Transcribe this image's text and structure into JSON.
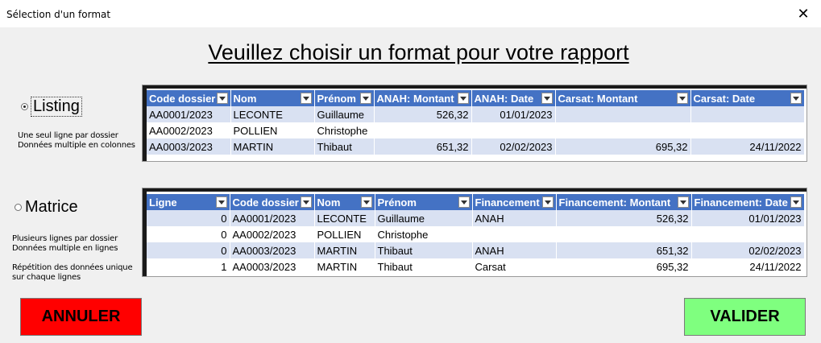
{
  "window": {
    "title": "Sélection d'un format",
    "close_glyph": "✕"
  },
  "heading": "Veuillez choisir un format pour votre rapport",
  "listing": {
    "label": "Listing",
    "selected": true,
    "desc": [
      "Une seul ligne par dossier",
      "Données multiple en colonnes"
    ],
    "columns": [
      "Code dossier",
      "Nom",
      "Prénom",
      "ANAH: Montant",
      "ANAH: Date",
      "Carsat: Montant",
      "Carsat: Date"
    ],
    "rows": [
      [
        "AA0001/2023",
        "LECONTE",
        "Guillaume",
        "526,32",
        "01/01/2023",
        "",
        ""
      ],
      [
        "AA0002/2023",
        "POLLIEN",
        "Christophe",
        "",
        "",
        "",
        ""
      ],
      [
        "AA0003/2023",
        "MARTIN",
        "Thibaut",
        "651,32",
        "02/02/2023",
        "695,32",
        "24/11/2022"
      ]
    ]
  },
  "matrice": {
    "label": "Matrice",
    "selected": false,
    "desc": [
      "Plusieurs lignes par dossier",
      "Données multiple en lignes",
      "",
      "Répétition des données unique",
      "sur chaque lignes"
    ],
    "columns": [
      "Ligne",
      "Code dossier",
      "Nom",
      "Prénom",
      "Financement",
      "Financement: Montant",
      "Financement: Date"
    ],
    "rows": [
      [
        "0",
        "AA0001/2023",
        "LECONTE",
        "Guillaume",
        "ANAH",
        "526,32",
        "01/01/2023"
      ],
      [
        "0",
        "AA0002/2023",
        "POLLIEN",
        "Christophe",
        "",
        "",
        ""
      ],
      [
        "0",
        "AA0003/2023",
        "MARTIN",
        "Thibaut",
        "ANAH",
        "651,32",
        "02/02/2023"
      ],
      [
        "1",
        "AA0003/2023",
        "MARTIN",
        "Thibaut",
        "Carsat",
        "695,32",
        "24/11/2022"
      ]
    ]
  },
  "buttons": {
    "cancel": "ANNULER",
    "ok": "VALIDER"
  },
  "colors": {
    "header": "#4472c4",
    "band": "#d9e1f2",
    "cancel": "#ff0000",
    "ok": "#7fff7f"
  }
}
